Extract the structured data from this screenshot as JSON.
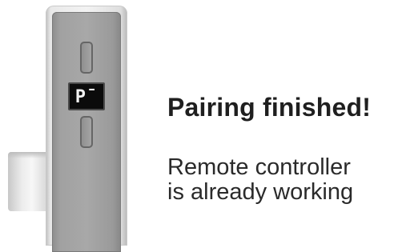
{
  "device": {
    "display_code": "P¯"
  },
  "status": {
    "title": "Pairing finished!",
    "message_line1": "Remote controller",
    "message_line2": "is already working"
  }
}
